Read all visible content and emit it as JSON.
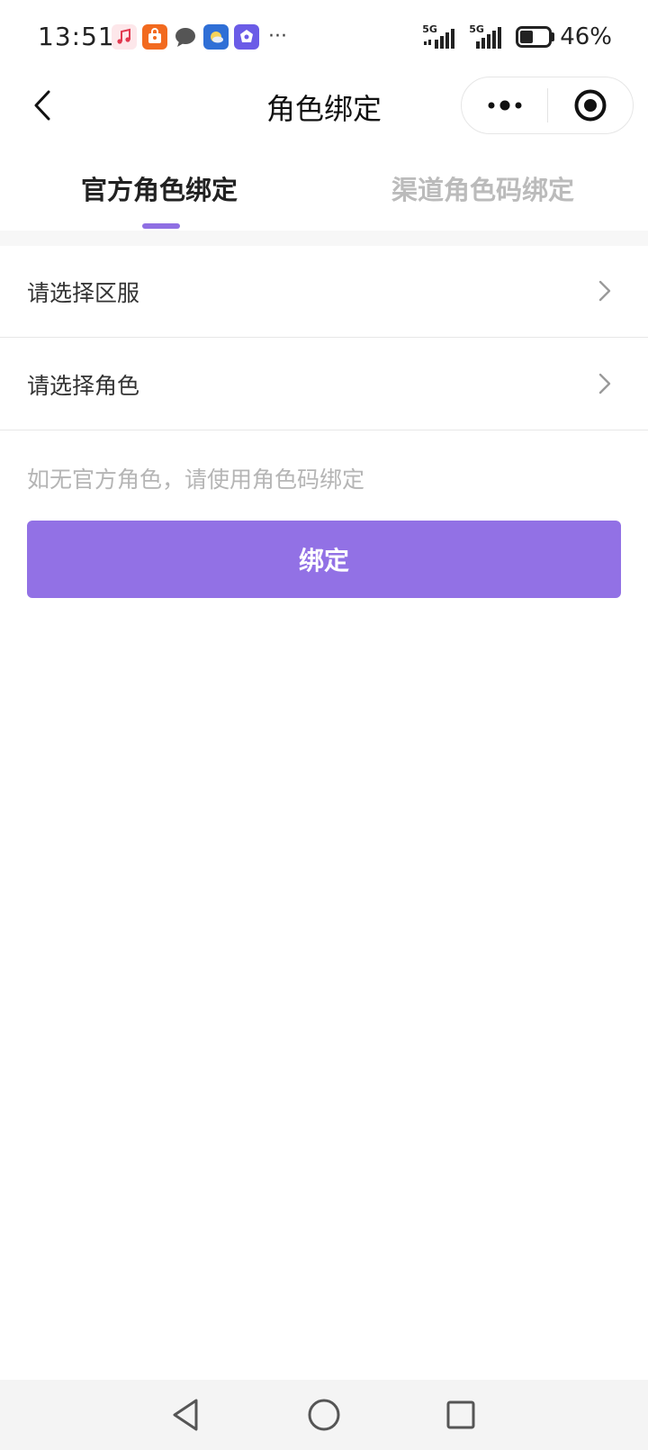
{
  "status_bar": {
    "time": "13:51",
    "notification_icons": [
      "music-icon",
      "shopping-icon",
      "message-icon",
      "weather-icon",
      "app-icon"
    ],
    "more": "···",
    "signal_1": "5G",
    "signal_2": "5G",
    "battery_percent": "46%"
  },
  "nav": {
    "title": "角色绑定"
  },
  "tabs": [
    {
      "label": "官方角色绑定",
      "active": true
    },
    {
      "label": "渠道角色码绑定",
      "active": false
    }
  ],
  "form": {
    "server_placeholder": "请选择区服",
    "role_placeholder": "请选择角色",
    "hint": "如无官方角色，请使用角色码绑定",
    "bind_label": "绑定"
  },
  "colors": {
    "accent": "#9271e5",
    "tab_inactive": "#bbbbbb",
    "hint": "#b5b5b5"
  }
}
